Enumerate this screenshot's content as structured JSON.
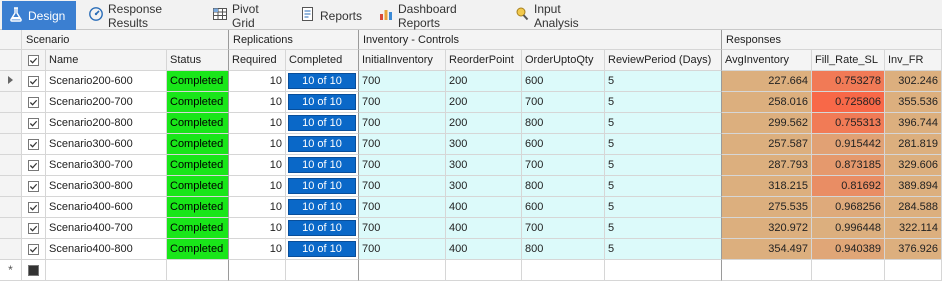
{
  "tabs": [
    {
      "label": "Design",
      "icon": "flask-icon",
      "active": true
    },
    {
      "label": "Response Results",
      "icon": "gauge-icon",
      "active": false
    },
    {
      "label": "Pivot Grid",
      "icon": "pivot-grid-icon",
      "active": false
    },
    {
      "label": "Reports",
      "icon": "report-icon",
      "active": false
    },
    {
      "label": "Dashboard Reports",
      "icon": "bar-chart-icon",
      "active": false
    },
    {
      "label": "Input Analysis",
      "icon": "input-analysis-icon",
      "active": false
    }
  ],
  "bands": {
    "scenario": "Scenario",
    "replications": "Replications",
    "inventory_controls": "Inventory -  Controls",
    "responses": "Responses"
  },
  "columns": {
    "name": "Name",
    "status": "Status",
    "required": "Required",
    "completed": "Completed",
    "initial_inventory": "InitialInventory",
    "reorder_point": "ReorderPoint",
    "order_upto_qty": "OrderUptoQty",
    "review_period": "ReviewPeriod (Days)",
    "avg_inventory": "AvgInventory",
    "fill_rate_sl": "Fill_Rate_SL",
    "inv_fr": "Inv_FR"
  },
  "colors": {
    "completed_status": "#19e619",
    "completed_badge": "#0a68c8",
    "controls_bg": "#dcfafa",
    "responses_bg": "#dcaf7e",
    "fill_rate_low": "#f86848",
    "fill_rate_high": "#dcaf7e"
  },
  "rows": [
    {
      "name": "Scenario200-600",
      "status": "Completed",
      "required": "10",
      "completed": "10 of 10",
      "initial_inventory": "700",
      "reorder_point": "200",
      "order_upto_qty": "600",
      "review_period": "5",
      "avg_inventory": "227.664",
      "fill_rate_sl": "0.753278",
      "inv_fr": "302.246"
    },
    {
      "name": "Scenario200-700",
      "status": "Completed",
      "required": "10",
      "completed": "10 of 10",
      "initial_inventory": "700",
      "reorder_point": "200",
      "order_upto_qty": "700",
      "review_period": "5",
      "avg_inventory": "258.016",
      "fill_rate_sl": "0.725806",
      "inv_fr": "355.536"
    },
    {
      "name": "Scenario200-800",
      "status": "Completed",
      "required": "10",
      "completed": "10 of 10",
      "initial_inventory": "700",
      "reorder_point": "200",
      "order_upto_qty": "800",
      "review_period": "5",
      "avg_inventory": "299.562",
      "fill_rate_sl": "0.755313",
      "inv_fr": "396.744"
    },
    {
      "name": "Scenario300-600",
      "status": "Completed",
      "required": "10",
      "completed": "10 of 10",
      "initial_inventory": "700",
      "reorder_point": "300",
      "order_upto_qty": "600",
      "review_period": "5",
      "avg_inventory": "257.587",
      "fill_rate_sl": "0.915442",
      "inv_fr": "281.819"
    },
    {
      "name": "Scenario300-700",
      "status": "Completed",
      "required": "10",
      "completed": "10 of 10",
      "initial_inventory": "700",
      "reorder_point": "300",
      "order_upto_qty": "700",
      "review_period": "5",
      "avg_inventory": "287.793",
      "fill_rate_sl": "0.873185",
      "inv_fr": "329.606"
    },
    {
      "name": "Scenario300-800",
      "status": "Completed",
      "required": "10",
      "completed": "10 of 10",
      "initial_inventory": "700",
      "reorder_point": "300",
      "order_upto_qty": "800",
      "review_period": "5",
      "avg_inventory": "318.215",
      "fill_rate_sl": "0.81692",
      "inv_fr": "389.894"
    },
    {
      "name": "Scenario400-600",
      "status": "Completed",
      "required": "10",
      "completed": "10 of 10",
      "initial_inventory": "700",
      "reorder_point": "400",
      "order_upto_qty": "600",
      "review_period": "5",
      "avg_inventory": "275.535",
      "fill_rate_sl": "0.968256",
      "inv_fr": "284.588"
    },
    {
      "name": "Scenario400-700",
      "status": "Completed",
      "required": "10",
      "completed": "10 of 10",
      "initial_inventory": "700",
      "reorder_point": "400",
      "order_upto_qty": "700",
      "review_period": "5",
      "avg_inventory": "320.972",
      "fill_rate_sl": "0.996448",
      "inv_fr": "322.114"
    },
    {
      "name": "Scenario400-800",
      "status": "Completed",
      "required": "10",
      "completed": "10 of 10",
      "initial_inventory": "700",
      "reorder_point": "400",
      "order_upto_qty": "800",
      "review_period": "5",
      "avg_inventory": "354.497",
      "fill_rate_sl": "0.940389",
      "inv_fr": "376.926"
    }
  ]
}
